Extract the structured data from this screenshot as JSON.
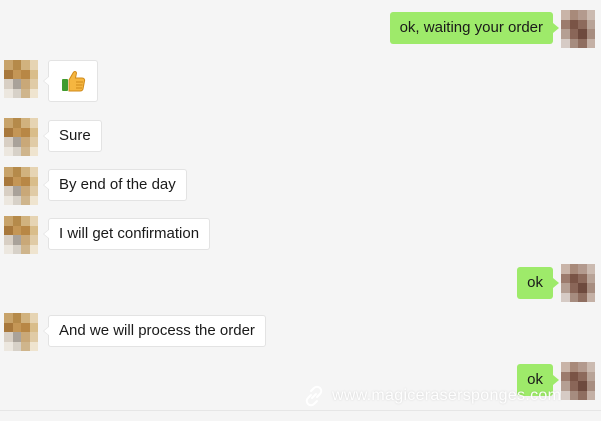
{
  "messages": [
    {
      "side": "out",
      "text": "ok,  waiting your order"
    },
    {
      "side": "in",
      "emoji": "thumbs-up-icon"
    },
    {
      "side": "in",
      "text": "Sure"
    },
    {
      "side": "in",
      "text": "By end of the day"
    },
    {
      "side": "in",
      "text": "I will get confirmation"
    },
    {
      "side": "out",
      "text": "ok"
    },
    {
      "side": "in",
      "text": "And we will process the order"
    },
    {
      "side": "out",
      "text": "ok"
    }
  ],
  "watermark": {
    "text": "www.magicerasersponges.com",
    "icon": "link-icon"
  },
  "colors": {
    "background": "#f5f5f5",
    "outgoing_bubble": "#9eea6a",
    "incoming_bubble": "#ffffff"
  }
}
